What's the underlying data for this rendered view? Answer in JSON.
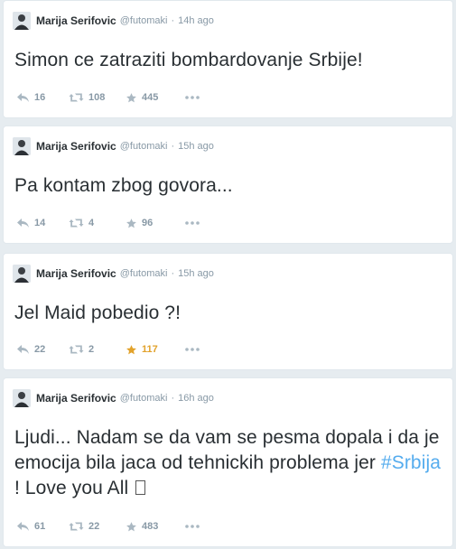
{
  "author": {
    "name": "Marija Serifovic",
    "handle": "@futomaki",
    "separator": "·"
  },
  "tweets": [
    {
      "time": "14h ago",
      "text": "Simon ce zatraziti bombardovanje Srbije!",
      "replies": "16",
      "retweets": "108",
      "favorites": "445",
      "favorited": false
    },
    {
      "time": "15h ago",
      "text": "Pa kontam zbog govora...",
      "replies": "14",
      "retweets": "4",
      "favorites": "96",
      "favorited": false
    },
    {
      "time": "15h ago",
      "text": "Jel Maid pobedio ?!",
      "replies": "22",
      "retweets": "2",
      "favorites": "117",
      "favorited": true
    },
    {
      "time": "16h ago",
      "text_before": "Ljudi... Nadam se da vam se pesma dopala i da je emocija bila jaca od tehnickih problema jer ",
      "hashtag": "#Srbija",
      "text_after": " ! Love you All ",
      "replies": "61",
      "retweets": "22",
      "favorites": "483",
      "favorited": false
    }
  ],
  "colors": {
    "background": "#e6ecf0",
    "icon": "#aab8c2",
    "hashtag": "#55acee",
    "favorite_active": "#e2a22b"
  },
  "icons": {
    "reply": "reply-icon",
    "retweet": "retweet-icon",
    "favorite": "star-icon",
    "more": "more-icon"
  }
}
